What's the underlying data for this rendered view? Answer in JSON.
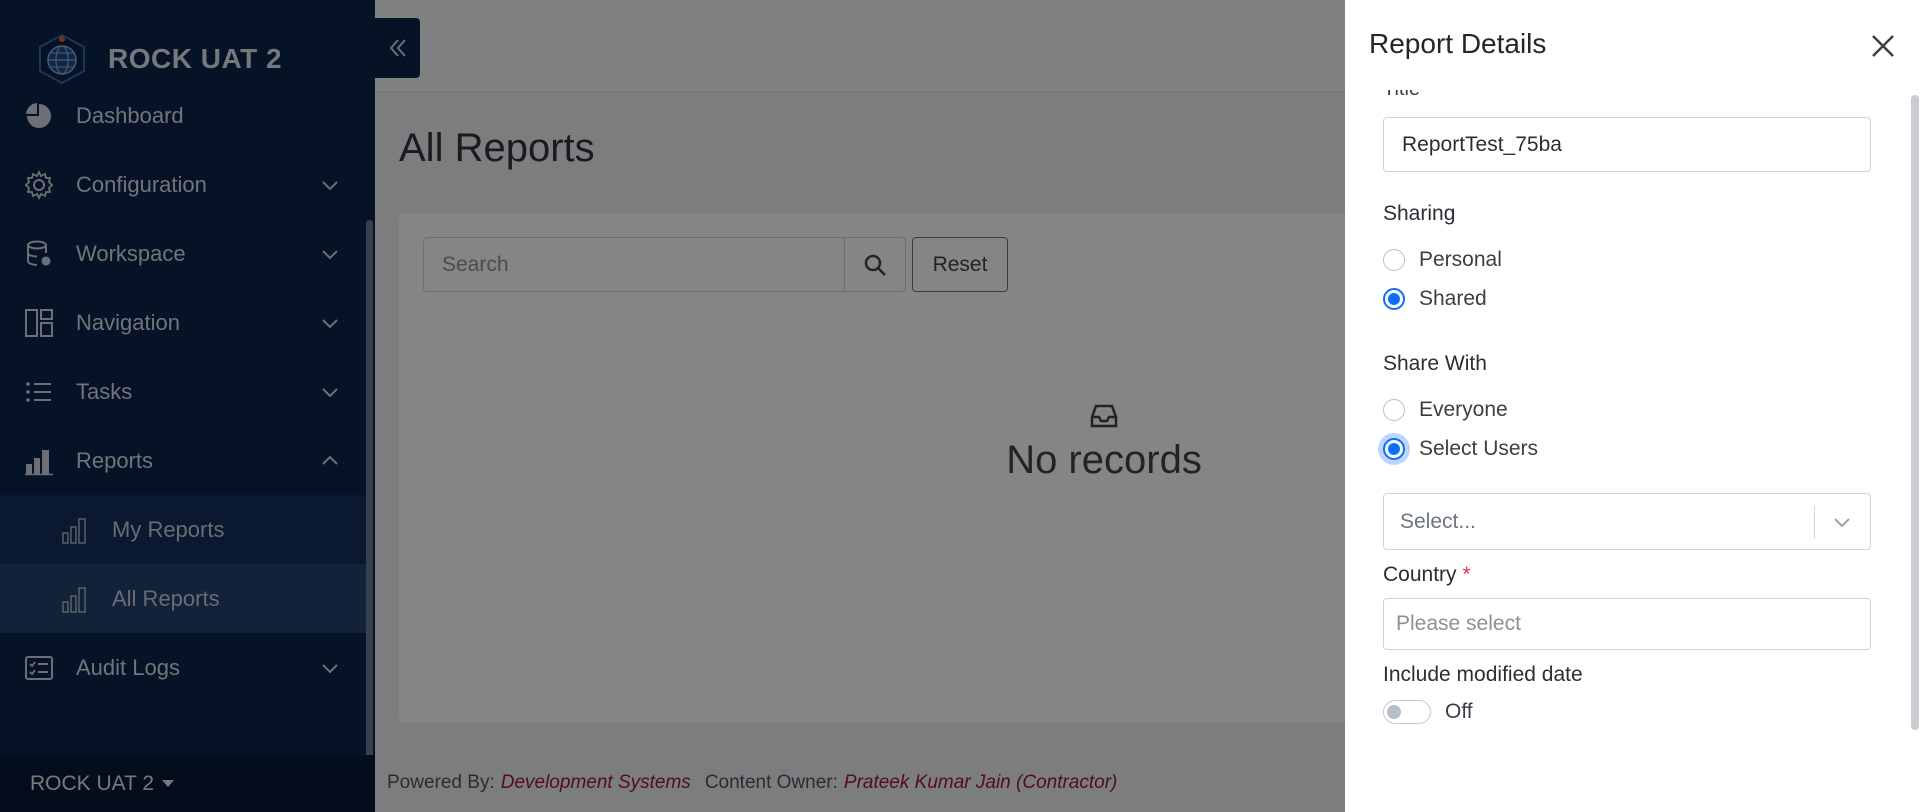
{
  "sidebar": {
    "brand": "ROCK UAT 2",
    "items": [
      {
        "label": "Dashboard",
        "icon": "pie-chart-icon"
      },
      {
        "label": "Configuration",
        "icon": "gear-icon"
      },
      {
        "label": "Workspace",
        "icon": "database-gear-icon"
      },
      {
        "label": "Navigation",
        "icon": "layout-icon"
      },
      {
        "label": "Tasks",
        "icon": "list-icon"
      },
      {
        "label": "Reports",
        "icon": "bar-chart-icon"
      },
      {
        "label": "Audit Logs",
        "icon": "checklist-icon"
      }
    ],
    "sub_items": [
      {
        "label": "My Reports",
        "icon": "bar-chart-outline-icon"
      },
      {
        "label": "All Reports",
        "icon": "bar-chart-outline-icon"
      }
    ],
    "footer_label": "ROCK UAT 2"
  },
  "main": {
    "title": "All Reports",
    "search_placeholder": "Search",
    "reset_label": "Reset",
    "empty_text": "No records",
    "footer": {
      "powered_by_label": "Powered By:",
      "powered_by_value": "Development Systems",
      "content_owner_label": "Content Owner:",
      "content_owner_value": "Prateek Kumar Jain (Contractor)"
    }
  },
  "drawer": {
    "title": "Report Details",
    "title_field_label": "Title",
    "title_value": "ReportTest_75ba",
    "sharing_label": "Sharing",
    "sharing_options": [
      "Personal",
      "Shared"
    ],
    "sharing_selected": "Shared",
    "share_with_label": "Share With",
    "share_with_options": [
      "Everyone",
      "Select Users"
    ],
    "share_with_selected": "Select Users",
    "users_placeholder": "Select...",
    "country_label": "Country",
    "country_required": "*",
    "country_placeholder": "Please select",
    "modified_date_label": "Include modified date",
    "modified_date_state": "Off"
  },
  "colors": {
    "sidebar_bg": "#0d2447",
    "accent": "#0d6efd",
    "link": "#a01840"
  }
}
